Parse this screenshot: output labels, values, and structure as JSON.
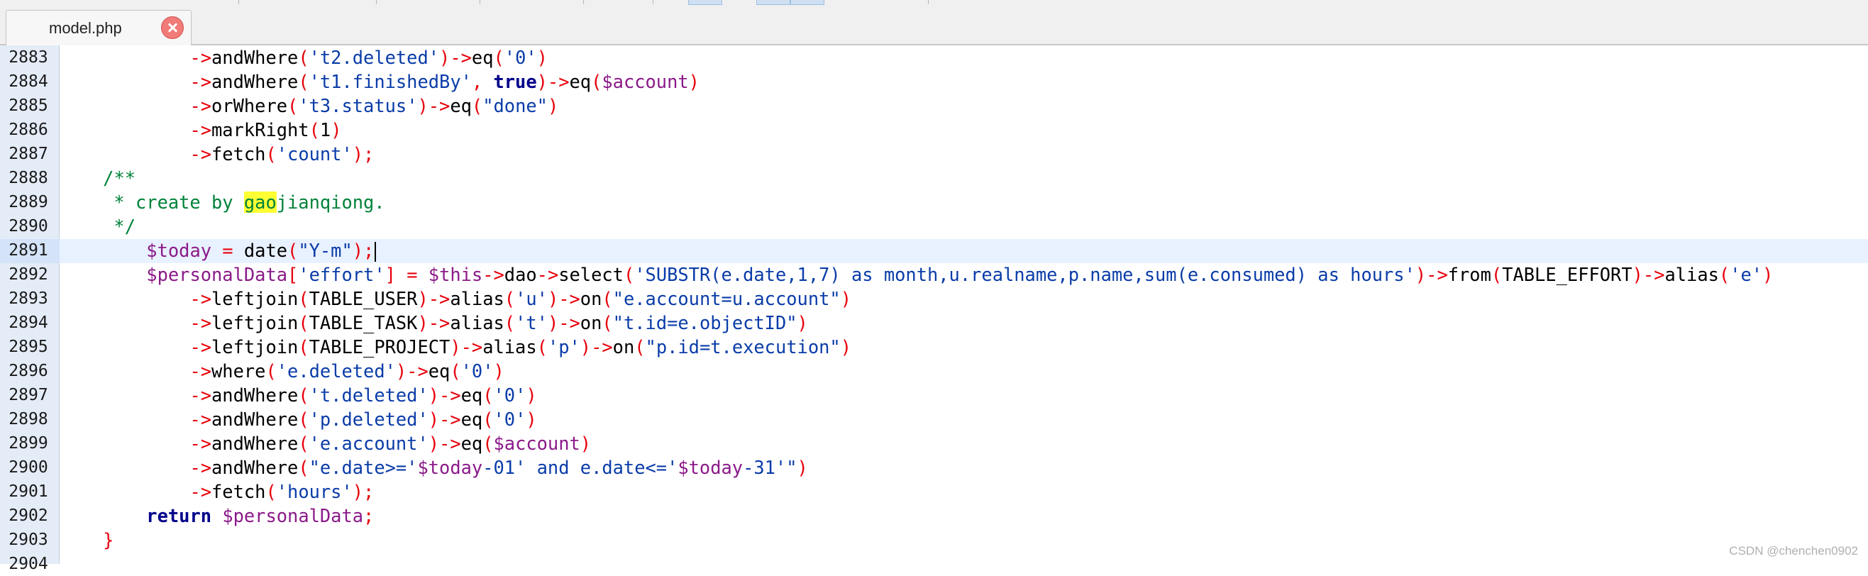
{
  "tab": {
    "title": "model.php",
    "close_icon": "close-icon",
    "accent": "#f07b78"
  },
  "editor": {
    "current_line": "2891",
    "lines": [
      {
        "n": "2883",
        "tokens": [
          {
            "t": "            ",
            "c": "plain"
          },
          {
            "t": "->",
            "c": "op"
          },
          {
            "t": "andWhere",
            "c": "plain"
          },
          {
            "t": "(",
            "c": "op"
          },
          {
            "t": "'t2.deleted'",
            "c": "str"
          },
          {
            "t": ")->",
            "c": "op"
          },
          {
            "t": "eq",
            "c": "plain"
          },
          {
            "t": "(",
            "c": "op"
          },
          {
            "t": "'0'",
            "c": "str"
          },
          {
            "t": ")",
            "c": "op"
          }
        ]
      },
      {
        "n": "2884",
        "tokens": [
          {
            "t": "            ",
            "c": "plain"
          },
          {
            "t": "->",
            "c": "op"
          },
          {
            "t": "andWhere",
            "c": "plain"
          },
          {
            "t": "(",
            "c": "op"
          },
          {
            "t": "'t1.finishedBy'",
            "c": "str"
          },
          {
            "t": ", ",
            "c": "op"
          },
          {
            "t": "true",
            "c": "kw"
          },
          {
            "t": ")->",
            "c": "op"
          },
          {
            "t": "eq",
            "c": "plain"
          },
          {
            "t": "(",
            "c": "op"
          },
          {
            "t": "$account",
            "c": "var"
          },
          {
            "t": ")",
            "c": "op"
          }
        ]
      },
      {
        "n": "2885",
        "tokens": [
          {
            "t": "            ",
            "c": "plain"
          },
          {
            "t": "->",
            "c": "op"
          },
          {
            "t": "orWhere",
            "c": "plain"
          },
          {
            "t": "(",
            "c": "op"
          },
          {
            "t": "'t3.status'",
            "c": "str"
          },
          {
            "t": ")->",
            "c": "op"
          },
          {
            "t": "eq",
            "c": "plain"
          },
          {
            "t": "(",
            "c": "op"
          },
          {
            "t": "\"done\"",
            "c": "str"
          },
          {
            "t": ")",
            "c": "op"
          }
        ]
      },
      {
        "n": "2886",
        "tokens": [
          {
            "t": "            ",
            "c": "plain"
          },
          {
            "t": "->",
            "c": "op"
          },
          {
            "t": "markRight",
            "c": "plain"
          },
          {
            "t": "(",
            "c": "op"
          },
          {
            "t": "1",
            "c": "plain"
          },
          {
            "t": ")",
            "c": "op"
          }
        ]
      },
      {
        "n": "2887",
        "tokens": [
          {
            "t": "            ",
            "c": "plain"
          },
          {
            "t": "->",
            "c": "op"
          },
          {
            "t": "fetch",
            "c": "plain"
          },
          {
            "t": "(",
            "c": "op"
          },
          {
            "t": "'count'",
            "c": "str"
          },
          {
            "t": ");",
            "c": "op"
          }
        ]
      },
      {
        "n": "2888",
        "tokens": [
          {
            "t": "    ",
            "c": "plain"
          },
          {
            "t": "/**",
            "c": "comment"
          }
        ]
      },
      {
        "n": "2889",
        "tokens": [
          {
            "t": "     * create by ",
            "c": "comment"
          },
          {
            "t": "gao",
            "c": "hl"
          },
          {
            "t": "jianqiong.",
            "c": "comment"
          }
        ]
      },
      {
        "n": "2890",
        "tokens": [
          {
            "t": "     */",
            "c": "comment"
          }
        ]
      },
      {
        "n": "2891",
        "tokens": [
          {
            "t": "        ",
            "c": "plain"
          },
          {
            "t": "$today",
            "c": "var"
          },
          {
            "t": " = ",
            "c": "op"
          },
          {
            "t": "date",
            "c": "plain"
          },
          {
            "t": "(",
            "c": "op"
          },
          {
            "t": "\"Y-m\"",
            "c": "str"
          },
          {
            "t": ");",
            "c": "op"
          }
        ],
        "caret": true
      },
      {
        "n": "2892",
        "tokens": [
          {
            "t": "        ",
            "c": "plain"
          },
          {
            "t": "$personalData",
            "c": "var"
          },
          {
            "t": "[",
            "c": "op"
          },
          {
            "t": "'effort'",
            "c": "str"
          },
          {
            "t": "] = ",
            "c": "op"
          },
          {
            "t": "$this",
            "c": "var"
          },
          {
            "t": "->",
            "c": "op"
          },
          {
            "t": "dao",
            "c": "plain"
          },
          {
            "t": "->",
            "c": "op"
          },
          {
            "t": "select",
            "c": "plain"
          },
          {
            "t": "(",
            "c": "op"
          },
          {
            "t": "'SUBSTR(e.date,1,7) as month,u.realname,p.name,sum(e.consumed) as hours'",
            "c": "str"
          },
          {
            "t": ")->",
            "c": "op"
          },
          {
            "t": "from",
            "c": "plain"
          },
          {
            "t": "(",
            "c": "op"
          },
          {
            "t": "TABLE_EFFORT",
            "c": "plain"
          },
          {
            "t": ")->",
            "c": "op"
          },
          {
            "t": "alias",
            "c": "plain"
          },
          {
            "t": "(",
            "c": "op"
          },
          {
            "t": "'e'",
            "c": "str"
          },
          {
            "t": ")",
            "c": "op"
          }
        ]
      },
      {
        "n": "2893",
        "tokens": [
          {
            "t": "            ",
            "c": "plain"
          },
          {
            "t": "->",
            "c": "op"
          },
          {
            "t": "leftjoin",
            "c": "plain"
          },
          {
            "t": "(",
            "c": "op"
          },
          {
            "t": "TABLE_USER",
            "c": "plain"
          },
          {
            "t": ")->",
            "c": "op"
          },
          {
            "t": "alias",
            "c": "plain"
          },
          {
            "t": "(",
            "c": "op"
          },
          {
            "t": "'u'",
            "c": "str"
          },
          {
            "t": ")->",
            "c": "op"
          },
          {
            "t": "on",
            "c": "plain"
          },
          {
            "t": "(",
            "c": "op"
          },
          {
            "t": "\"e.account=u.account\"",
            "c": "str"
          },
          {
            "t": ")",
            "c": "op"
          }
        ]
      },
      {
        "n": "2894",
        "tokens": [
          {
            "t": "            ",
            "c": "plain"
          },
          {
            "t": "->",
            "c": "op"
          },
          {
            "t": "leftjoin",
            "c": "plain"
          },
          {
            "t": "(",
            "c": "op"
          },
          {
            "t": "TABLE_TASK",
            "c": "plain"
          },
          {
            "t": ")->",
            "c": "op"
          },
          {
            "t": "alias",
            "c": "plain"
          },
          {
            "t": "(",
            "c": "op"
          },
          {
            "t": "'t'",
            "c": "str"
          },
          {
            "t": ")->",
            "c": "op"
          },
          {
            "t": "on",
            "c": "plain"
          },
          {
            "t": "(",
            "c": "op"
          },
          {
            "t": "\"t.id=e.objectID\"",
            "c": "str"
          },
          {
            "t": ")",
            "c": "op"
          }
        ]
      },
      {
        "n": "2895",
        "tokens": [
          {
            "t": "            ",
            "c": "plain"
          },
          {
            "t": "->",
            "c": "op"
          },
          {
            "t": "leftjoin",
            "c": "plain"
          },
          {
            "t": "(",
            "c": "op"
          },
          {
            "t": "TABLE_PROJECT",
            "c": "plain"
          },
          {
            "t": ")->",
            "c": "op"
          },
          {
            "t": "alias",
            "c": "plain"
          },
          {
            "t": "(",
            "c": "op"
          },
          {
            "t": "'p'",
            "c": "str"
          },
          {
            "t": ")->",
            "c": "op"
          },
          {
            "t": "on",
            "c": "plain"
          },
          {
            "t": "(",
            "c": "op"
          },
          {
            "t": "\"p.id=t.execution\"",
            "c": "str"
          },
          {
            "t": ")",
            "c": "op"
          }
        ]
      },
      {
        "n": "2896",
        "tokens": [
          {
            "t": "            ",
            "c": "plain"
          },
          {
            "t": "->",
            "c": "op"
          },
          {
            "t": "where",
            "c": "plain"
          },
          {
            "t": "(",
            "c": "op"
          },
          {
            "t": "'e.deleted'",
            "c": "str"
          },
          {
            "t": ")->",
            "c": "op"
          },
          {
            "t": "eq",
            "c": "plain"
          },
          {
            "t": "(",
            "c": "op"
          },
          {
            "t": "'0'",
            "c": "str"
          },
          {
            "t": ")",
            "c": "op"
          }
        ]
      },
      {
        "n": "2897",
        "tokens": [
          {
            "t": "            ",
            "c": "plain"
          },
          {
            "t": "->",
            "c": "op"
          },
          {
            "t": "andWhere",
            "c": "plain"
          },
          {
            "t": "(",
            "c": "op"
          },
          {
            "t": "'t.deleted'",
            "c": "str"
          },
          {
            "t": ")->",
            "c": "op"
          },
          {
            "t": "eq",
            "c": "plain"
          },
          {
            "t": "(",
            "c": "op"
          },
          {
            "t": "'0'",
            "c": "str"
          },
          {
            "t": ")",
            "c": "op"
          }
        ]
      },
      {
        "n": "2898",
        "tokens": [
          {
            "t": "            ",
            "c": "plain"
          },
          {
            "t": "->",
            "c": "op"
          },
          {
            "t": "andWhere",
            "c": "plain"
          },
          {
            "t": "(",
            "c": "op"
          },
          {
            "t": "'p.deleted'",
            "c": "str"
          },
          {
            "t": ")->",
            "c": "op"
          },
          {
            "t": "eq",
            "c": "plain"
          },
          {
            "t": "(",
            "c": "op"
          },
          {
            "t": "'0'",
            "c": "str"
          },
          {
            "t": ")",
            "c": "op"
          }
        ]
      },
      {
        "n": "2899",
        "tokens": [
          {
            "t": "            ",
            "c": "plain"
          },
          {
            "t": "->",
            "c": "op"
          },
          {
            "t": "andWhere",
            "c": "plain"
          },
          {
            "t": "(",
            "c": "op"
          },
          {
            "t": "'e.account'",
            "c": "str"
          },
          {
            "t": ")->",
            "c": "op"
          },
          {
            "t": "eq",
            "c": "plain"
          },
          {
            "t": "(",
            "c": "op"
          },
          {
            "t": "$account",
            "c": "var"
          },
          {
            "t": ")",
            "c": "op"
          }
        ]
      },
      {
        "n": "2900",
        "tokens": [
          {
            "t": "            ",
            "c": "plain"
          },
          {
            "t": "->",
            "c": "op"
          },
          {
            "t": "andWhere",
            "c": "plain"
          },
          {
            "t": "(",
            "c": "op"
          },
          {
            "t": "\"e.date>='",
            "c": "str"
          },
          {
            "t": "$today",
            "c": "var"
          },
          {
            "t": "-01' and e.date<='",
            "c": "str"
          },
          {
            "t": "$today",
            "c": "var"
          },
          {
            "t": "-31'\"",
            "c": "str"
          },
          {
            "t": ")",
            "c": "op"
          }
        ]
      },
      {
        "n": "2901",
        "tokens": [
          {
            "t": "            ",
            "c": "plain"
          },
          {
            "t": "->",
            "c": "op"
          },
          {
            "t": "fetch",
            "c": "plain"
          },
          {
            "t": "(",
            "c": "op"
          },
          {
            "t": "'hours'",
            "c": "str"
          },
          {
            "t": ");",
            "c": "op"
          }
        ]
      },
      {
        "n": "2902",
        "tokens": [
          {
            "t": "        ",
            "c": "plain"
          },
          {
            "t": "return",
            "c": "kw"
          },
          {
            "t": " ",
            "c": "plain"
          },
          {
            "t": "$personalData",
            "c": "var"
          },
          {
            "t": ";",
            "c": "op"
          }
        ]
      },
      {
        "n": "2903",
        "tokens": [
          {
            "t": "    ",
            "c": "plain"
          },
          {
            "t": "}",
            "c": "op"
          }
        ]
      },
      {
        "n": "2904",
        "tokens": []
      }
    ]
  },
  "watermark": "CSDN @chenchen0902"
}
